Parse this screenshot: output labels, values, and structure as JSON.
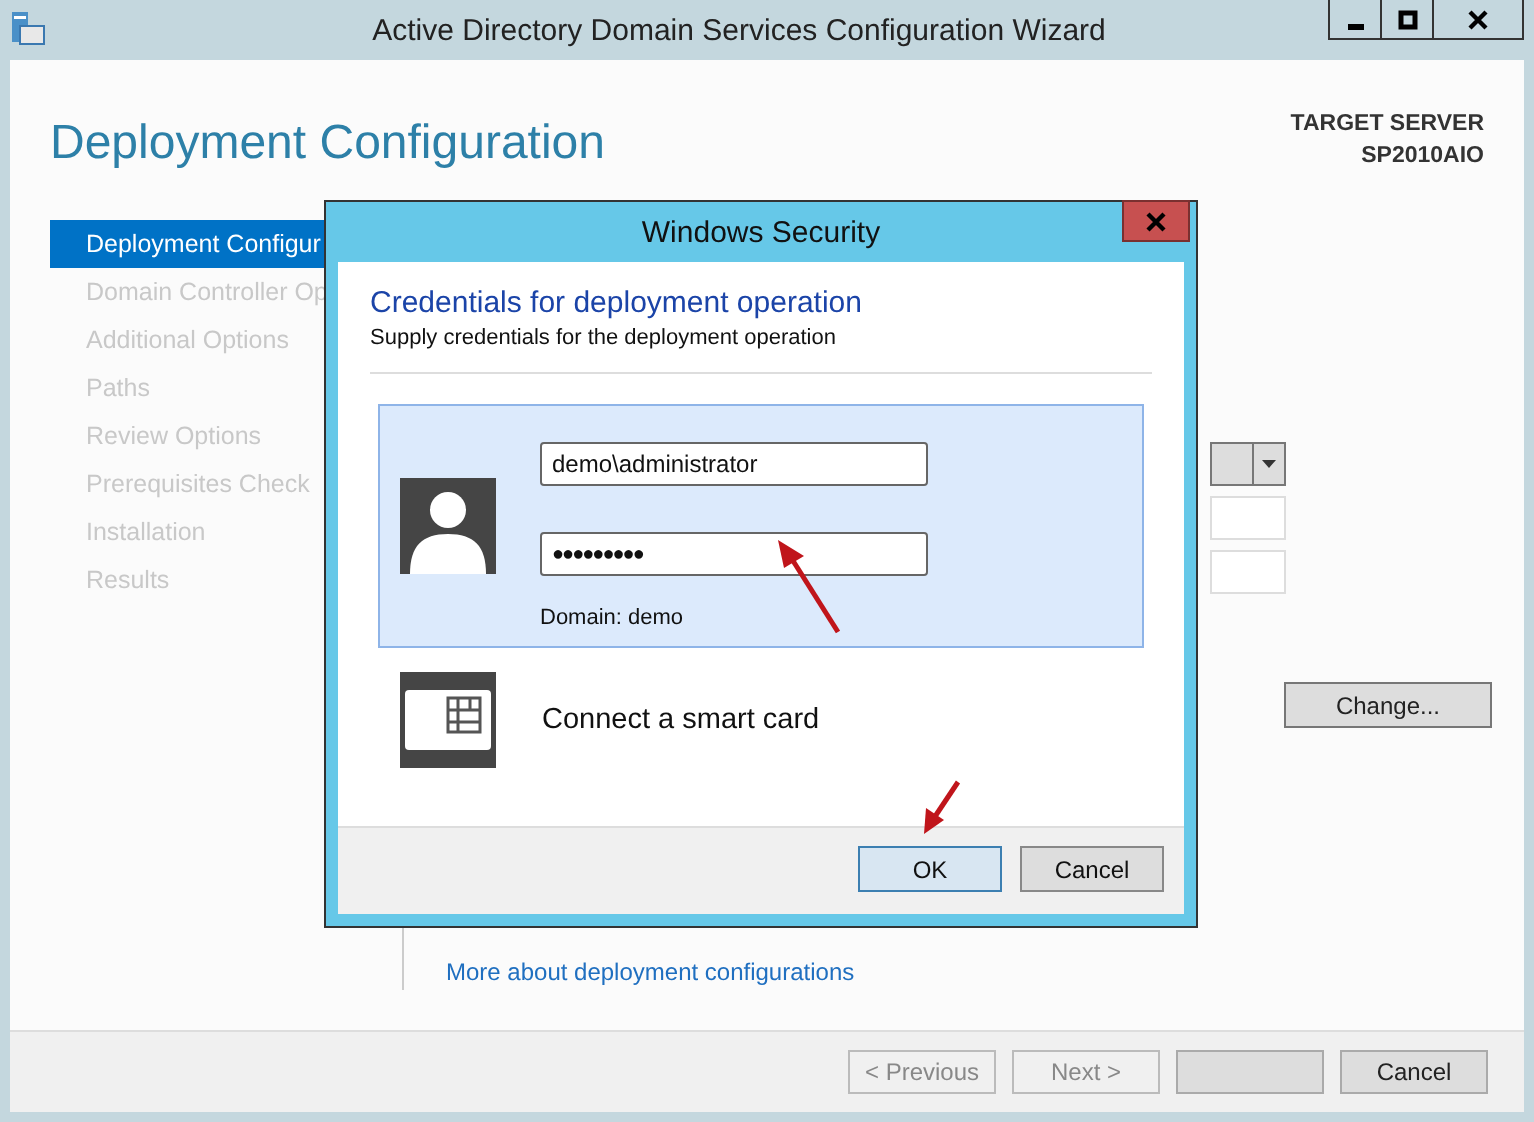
{
  "window": {
    "title": "Active Directory Domain Services Configuration Wizard"
  },
  "page": {
    "heading": "Deployment Configuration",
    "target_label": "TARGET SERVER",
    "target_name": "SP2010AIO"
  },
  "sidebar": {
    "items": [
      {
        "label": "Deployment Configur",
        "selected": true,
        "disabled": false
      },
      {
        "label": "Domain Controller Op",
        "selected": false,
        "disabled": true
      },
      {
        "label": "Additional Options",
        "selected": false,
        "disabled": true
      },
      {
        "label": "Paths",
        "selected": false,
        "disabled": true
      },
      {
        "label": "Review Options",
        "selected": false,
        "disabled": true
      },
      {
        "label": "Prerequisites Check",
        "selected": false,
        "disabled": true
      },
      {
        "label": "Installation",
        "selected": false,
        "disabled": true
      },
      {
        "label": "Results",
        "selected": false,
        "disabled": true
      }
    ]
  },
  "content": {
    "change_button": "Change...",
    "link": "More about deployment configurations"
  },
  "footer": {
    "buttons": [
      {
        "label": "< Previous",
        "disabled": true
      },
      {
        "label": "Next >",
        "disabled": true
      },
      {
        "disabled": false
      },
      {
        "label": "Cancel",
        "disabled": false
      }
    ]
  },
  "dialog": {
    "title": "Windows Security",
    "heading": "Credentials for deployment operation",
    "subtitle": "Supply credentials for the deployment operation",
    "username": "demo\\administrator",
    "password": "●●●●●●●●●",
    "domain": "Domain: demo",
    "smart_card": "Connect a smart card",
    "buttons": [
      {
        "label": "OK",
        "default": true
      },
      {
        "label": "Cancel",
        "default": false
      }
    ]
  }
}
